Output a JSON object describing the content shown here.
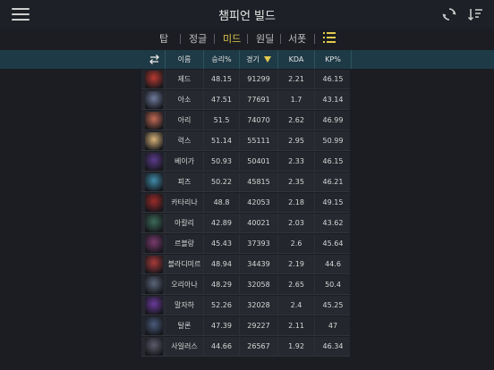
{
  "app": {
    "title": "챔피언 빌드"
  },
  "tabs": [
    {
      "label": "탑",
      "active": false
    },
    {
      "label": "정글",
      "active": false
    },
    {
      "label": "미드",
      "active": true
    },
    {
      "label": "원딜",
      "active": false
    },
    {
      "label": "서폿",
      "active": false
    }
  ],
  "columns": {
    "name": "이름",
    "winrate": "승리%",
    "games": "경기",
    "kda": "KDA",
    "kp": "KP%"
  },
  "rows": [
    {
      "name": "제드",
      "winrate": "48.15",
      "games": "91299",
      "kda": "2.21",
      "kp": "46.15",
      "avatar_color": "#b83a32"
    },
    {
      "name": "아소",
      "winrate": "47.51",
      "games": "77691",
      "kda": "1.7",
      "kp": "43.14",
      "avatar_color": "#6f7a9c"
    },
    {
      "name": "아리",
      "winrate": "51.5",
      "games": "74070",
      "kda": "2.62",
      "kp": "46.99",
      "avatar_color": "#c26a55"
    },
    {
      "name": "럭스",
      "winrate": "51.14",
      "games": "55111",
      "kda": "2.95",
      "kp": "50.99",
      "avatar_color": "#d8b27a"
    },
    {
      "name": "베이가",
      "winrate": "50.93",
      "games": "50401",
      "kda": "2.33",
      "kp": "46.15",
      "avatar_color": "#5a3a8a"
    },
    {
      "name": "피즈",
      "winrate": "50.22",
      "games": "45815",
      "kda": "2.35",
      "kp": "46.21",
      "avatar_color": "#3f8aa8"
    },
    {
      "name": "카타리나",
      "winrate": "48.8",
      "games": "42053",
      "kda": "2.18",
      "kp": "49.15",
      "avatar_color": "#9a2a2a"
    },
    {
      "name": "아칼리",
      "winrate": "42.89",
      "games": "40021",
      "kda": "2.03",
      "kp": "43.62",
      "avatar_color": "#3c6a58"
    },
    {
      "name": "르블랑",
      "winrate": "45.43",
      "games": "37393",
      "kda": "2.6",
      "kp": "45.64",
      "avatar_color": "#7a3a6e"
    },
    {
      "name": "블라디미르",
      "winrate": "48.94",
      "games": "34439",
      "kda": "2.19",
      "kp": "44.6",
      "avatar_color": "#a83a3a"
    },
    {
      "name": "오리아나",
      "winrate": "48.29",
      "games": "32058",
      "kda": "2.65",
      "kp": "50.4",
      "avatar_color": "#5a6478"
    },
    {
      "name": "말자하",
      "winrate": "52.26",
      "games": "32028",
      "kda": "2.4",
      "kp": "45.25",
      "avatar_color": "#6a3a9a"
    },
    {
      "name": "탈론",
      "winrate": "47.39",
      "games": "29227",
      "kda": "2.11",
      "kp": "47",
      "avatar_color": "#4a5a7a"
    },
    {
      "name": "사일러스",
      "winrate": "44.66",
      "games": "26567",
      "kda": "1.92",
      "kp": "46.34",
      "avatar_color": "#5a5a6a"
    }
  ]
}
